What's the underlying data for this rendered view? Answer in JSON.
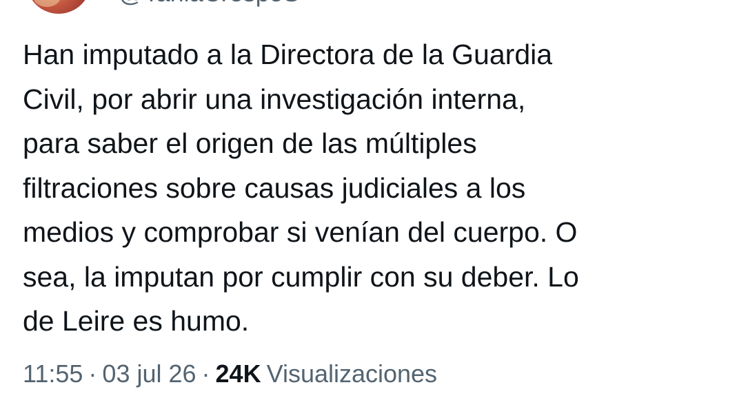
{
  "author": {
    "handle": "@TaniaCrespoS"
  },
  "tweet": {
    "text": "Han imputado a la Directora de la Guardia\nCivil, por abrir una investigación interna,\npara saber el origen de las múltiples\nfiltraciones sobre causas judiciales a los\nmedios y comprobar si venían del cuerpo. O\nsea, la imputan por cumplir con su deber. Lo\nde Leire es humo."
  },
  "meta": {
    "time": "11:55",
    "separator": "·",
    "date": "03 jul 26",
    "views_count": "24K",
    "views_label": "Visualizaciones"
  },
  "colors": {
    "text": "#0f1419",
    "secondary": "#536471",
    "background": "#ffffff"
  }
}
